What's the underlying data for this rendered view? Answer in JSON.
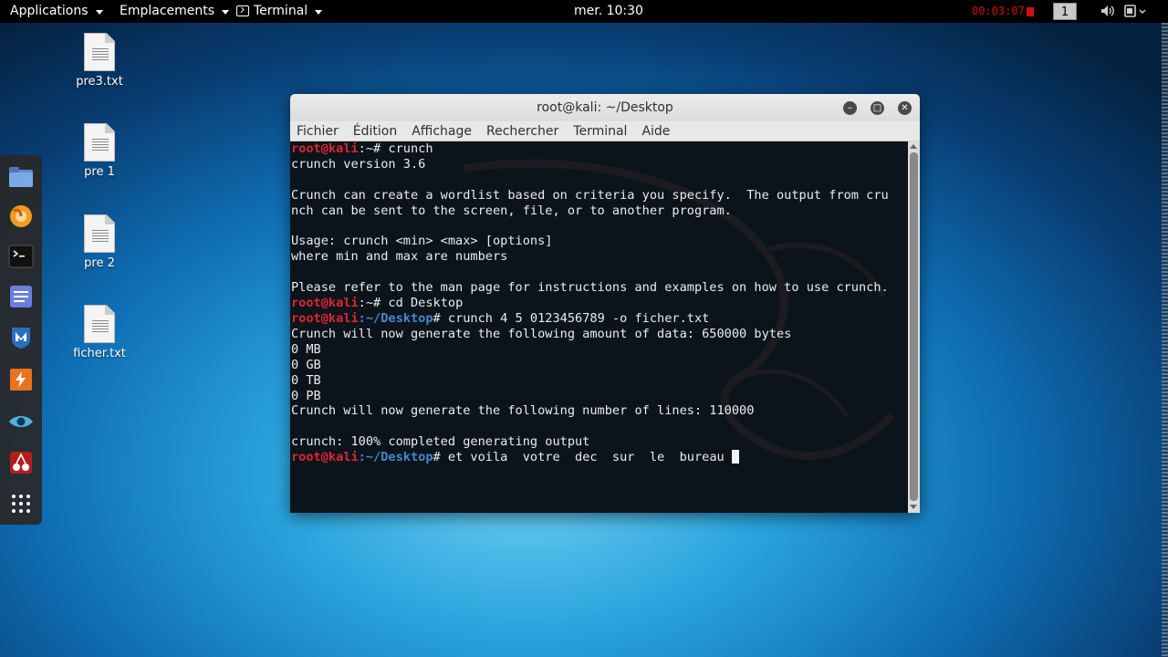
{
  "topbar": {
    "applications": "Applications",
    "places": "Emplacements",
    "terminal_app": "Terminal",
    "clock": "mer. 10:30",
    "recording": "00:03:07",
    "workspace": "1"
  },
  "colors": {
    "prompt_user": "#e02433",
    "prompt_path": "#4a86c8",
    "terminal_bg": "#0b141b",
    "recording": "#d01010"
  },
  "desktop": {
    "files": [
      {
        "label": "pre3.txt",
        "icon": "text-file-icon"
      },
      {
        "label": "pre 1",
        "icon": "text-file-icon"
      },
      {
        "label": "pre 2",
        "icon": "text-file-icon"
      },
      {
        "label": "ficher.txt",
        "icon": "text-file-icon"
      }
    ]
  },
  "dock": [
    "files-icon",
    "firefox-icon",
    "terminal-icon",
    "text-editor-icon",
    "metasploit-icon",
    "burpsuite-icon",
    "eye-icon",
    "cherrytree-icon",
    "app-grid-icon"
  ],
  "window": {
    "title": "root@kali: ~/Desktop",
    "menu": [
      "Fichier",
      "Édition",
      "Affichage",
      "Rechercher",
      "Terminal",
      "Aide"
    ]
  },
  "terminal": {
    "lines": [
      {
        "user": "root@kali",
        "path": ":~",
        "cmd": "# crunch"
      },
      {
        "text": "crunch version 3.6"
      },
      {
        "text": ""
      },
      {
        "text": "Crunch can create a wordlist based on criteria you specify.  The output from cru"
      },
      {
        "text": "nch can be sent to the screen, file, or to another program."
      },
      {
        "text": ""
      },
      {
        "text": "Usage: crunch <min> <max> [options]"
      },
      {
        "text": "where min and max are numbers"
      },
      {
        "text": ""
      },
      {
        "text": "Please refer to the man page for instructions and examples on how to use crunch."
      },
      {
        "user": "root@kali",
        "path": ":~",
        "cmd": "# cd Desktop"
      },
      {
        "user": "root@kali",
        "path": ":~/Desktop",
        "cmd": "# crunch 4 5 0123456789 -o ficher.txt"
      },
      {
        "text": "Crunch will now generate the following amount of data: 650000 bytes"
      },
      {
        "text": "0 MB"
      },
      {
        "text": "0 GB"
      },
      {
        "text": "0 TB"
      },
      {
        "text": "0 PB"
      },
      {
        "text": "Crunch will now generate the following number of lines: 110000"
      },
      {
        "text": ""
      },
      {
        "text": "crunch: 100% completed generating output"
      },
      {
        "user": "root@kali",
        "path": ":~/Desktop",
        "cmd": "# et voila  votre  dec  sur  le  bureau ",
        "cursor": true
      }
    ]
  }
}
